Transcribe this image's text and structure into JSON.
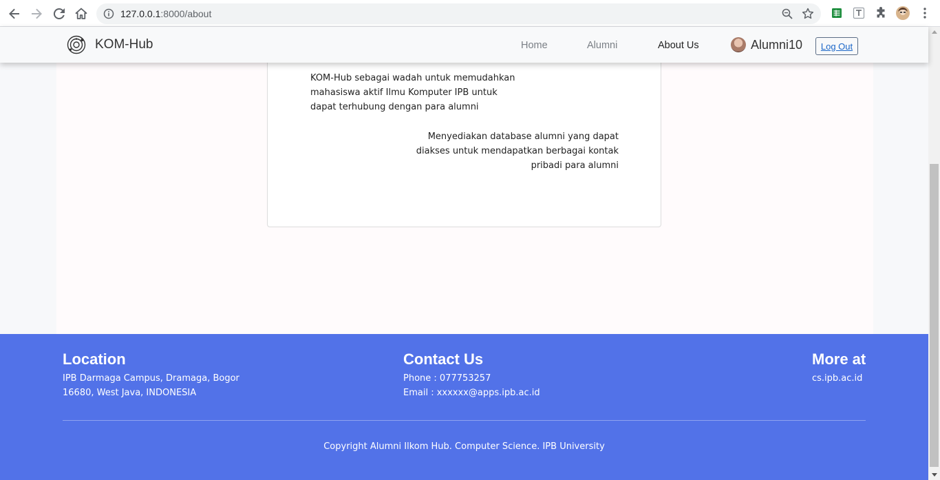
{
  "browser": {
    "url_host": "127.0.0.1",
    "url_path": ":8000/about"
  },
  "navbar": {
    "brand": "KOM-Hub",
    "links": [
      "Home",
      "Alumni",
      "About Us"
    ],
    "username": "Alumni10",
    "logout_label": "Log Out"
  },
  "about": {
    "paragraph1": "KOM-Hub sebagai wadah untuk memudahkan mahasiswa aktif Ilmu Komputer IPB untuk dapat terhubung dengan para alumni",
    "paragraph2": "Menyediakan database alumni yang dapat diakses untuk mendapatkan berbagai kontak pribadi para alumni"
  },
  "footer": {
    "location_title": "Location",
    "location_line1": "IPB Darmaga Campus, Dramaga, Bogor",
    "location_line2": "16680, West Java, INDONESIA",
    "contact_title": "Contact Us",
    "contact_phone": "Phone : 077753257",
    "contact_email": "Email : xxxxxx@apps.ipb.ac.id",
    "more_title": "More at",
    "more_link": "cs.ipb.ac.id",
    "copyright": "Copyright Alumni Ilkom Hub. Computer Science. IPB University"
  },
  "colors": {
    "footer_bg": "#5272e8",
    "navbar_bg": "#f8f9fa",
    "link_blue": "#1a66c8"
  }
}
